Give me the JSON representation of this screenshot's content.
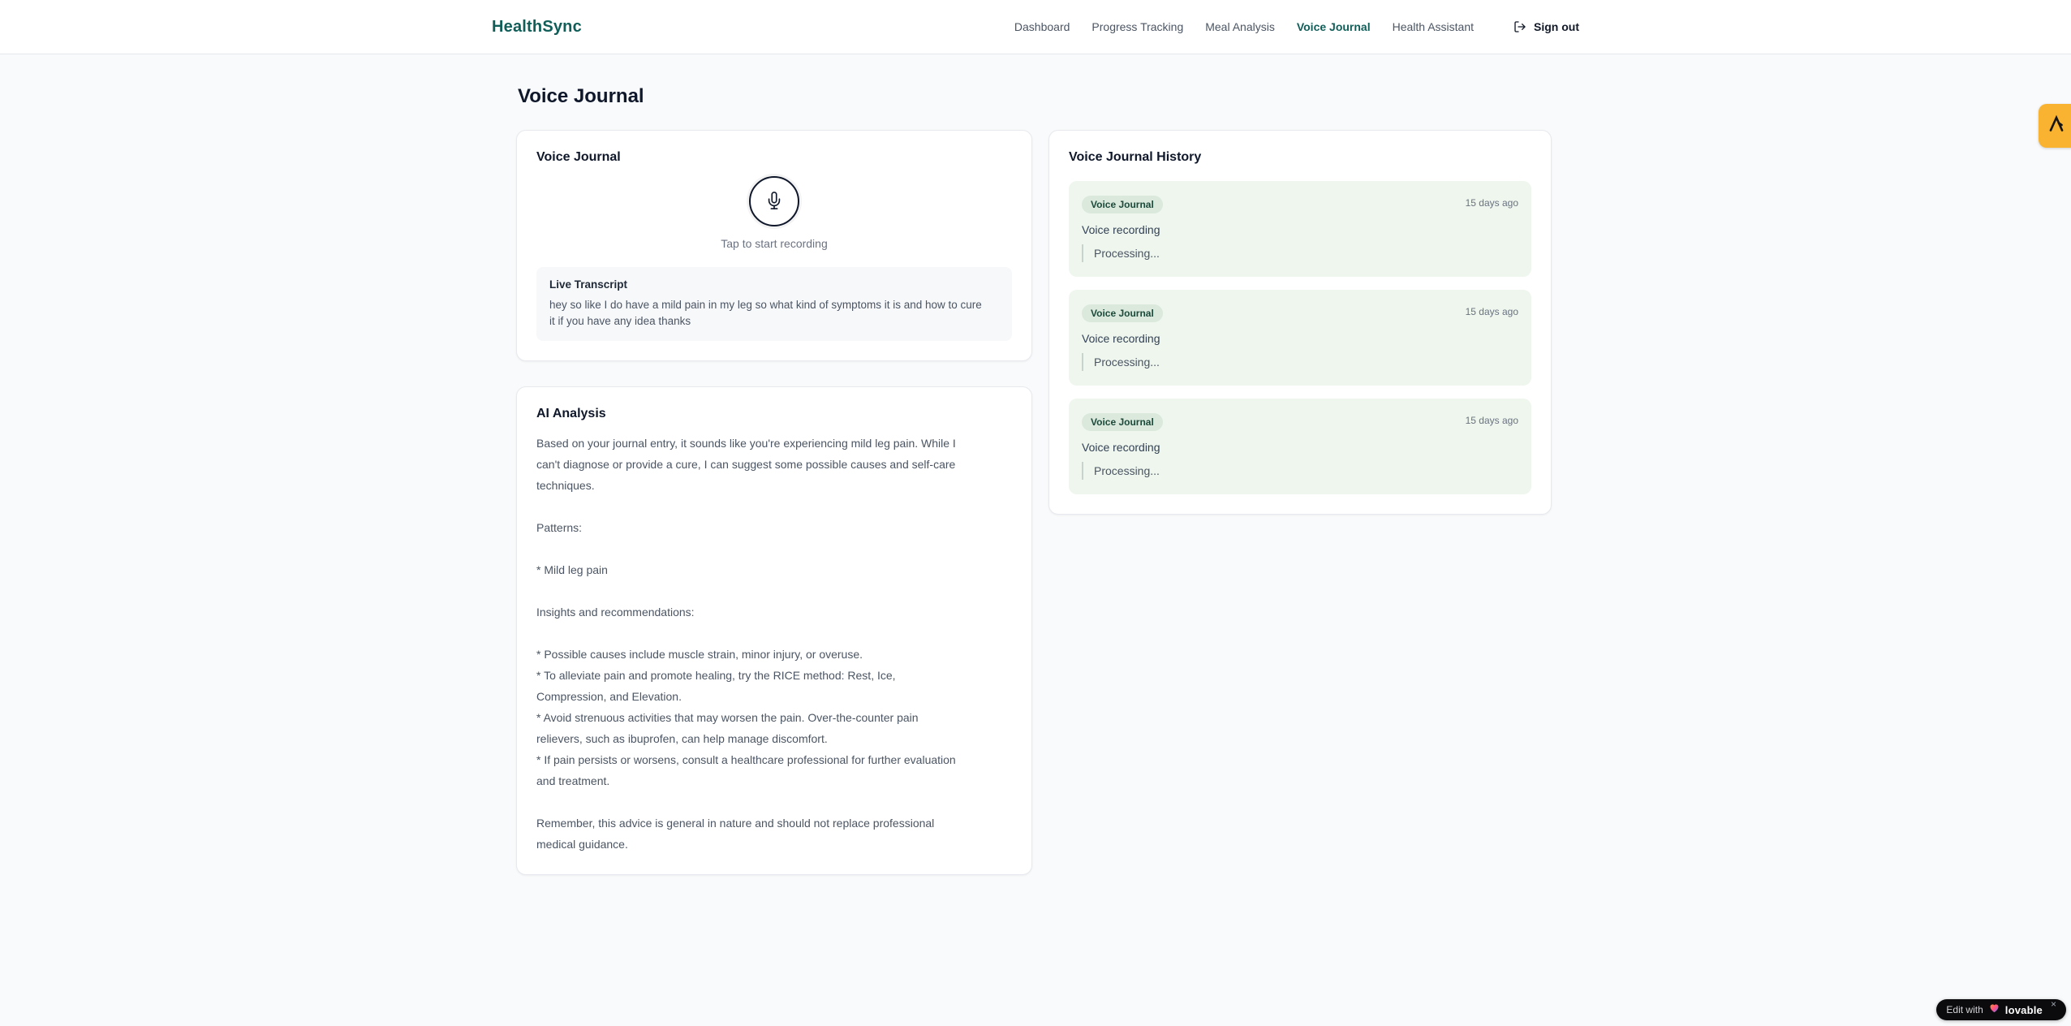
{
  "brand": {
    "name": "HealthSync"
  },
  "nav": {
    "items": [
      {
        "label": "Dashboard",
        "active": false
      },
      {
        "label": "Progress Tracking",
        "active": false
      },
      {
        "label": "Meal Analysis",
        "active": false
      },
      {
        "label": "Voice Journal",
        "active": true
      },
      {
        "label": "Health Assistant",
        "active": false
      }
    ],
    "sign_out_label": "Sign out"
  },
  "page": {
    "title": "Voice Journal"
  },
  "recorder_card": {
    "title": "Voice Journal",
    "tap_hint": "Tap to start recording",
    "live_transcript_label": "Live Transcript",
    "transcript_text": "hey so like I do have a mild pain in my leg so what kind of symptoms it is and how to cure\nit if you have any idea thanks"
  },
  "analysis_card": {
    "title": "AI Analysis",
    "body": "Based on your journal entry, it sounds like you're experiencing mild leg pain. While I\ncan't diagnose or provide a cure, I can suggest some possible causes and self-care\ntechniques.\n\nPatterns:\n\n* Mild leg pain\n\nInsights and recommendations:\n\n* Possible causes include muscle strain, minor injury, or overuse.\n* To alleviate pain and promote healing, try the RICE method: Rest, Ice,\nCompression, and Elevation.\n* Avoid strenuous activities that may worsen the pain. Over-the-counter pain\nrelievers, such as ibuprofen, can help manage discomfort.\n* If pain persists or worsens, consult a healthcare professional for further evaluation\nand treatment.\n\nRemember, this advice is general in nature and should not replace professional\nmedical guidance."
  },
  "history_card": {
    "title": "Voice Journal History",
    "entries": [
      {
        "badge": "Voice Journal",
        "time": "15 days ago",
        "title": "Voice recording",
        "status": "Processing..."
      },
      {
        "badge": "Voice Journal",
        "time": "15 days ago",
        "title": "Voice recording",
        "status": "Processing..."
      },
      {
        "badge": "Voice Journal",
        "time": "15 days ago",
        "title": "Voice recording",
        "status": "Processing..."
      }
    ]
  },
  "floating": {
    "edit_badge": {
      "prefix": "Edit with",
      "brand": "lovable",
      "close": "×"
    }
  },
  "icons": {
    "sign_out": "log-out-icon",
    "mic": "microphone-icon",
    "heart": "lovable-heart-icon",
    "edge_tab": "a-logo-icon"
  },
  "colors": {
    "accent_teal": "#115e59",
    "page_background": "#f9fafb",
    "card_border": "#e7e9ee",
    "history_entry_background": "#eef6ee",
    "badge_background": "#dbe8dc",
    "badge_text": "#1b4a3a",
    "edge_tab_amber": "#f9b331",
    "edit_badge_black": "#0b0b0e"
  }
}
